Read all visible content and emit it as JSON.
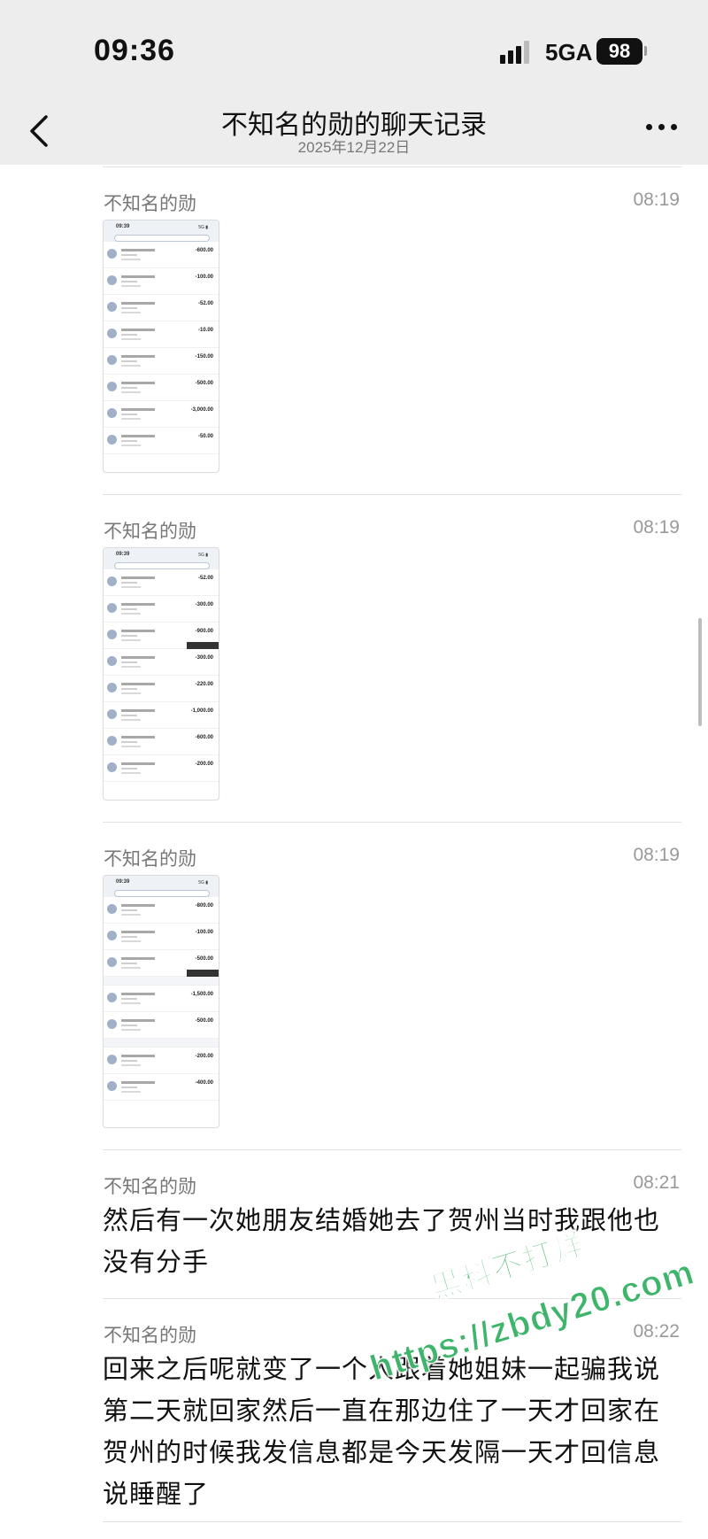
{
  "status_bar": {
    "time": "09:36",
    "network": "5GA",
    "battery": "98"
  },
  "nav": {
    "title": "不知名的勋的聊天记录",
    "date": "2025年12月22日"
  },
  "messages": [
    {
      "sender": "不知名的勋",
      "time": "08:19",
      "type": "image",
      "thumb_amounts": [
        "-600.00",
        "-100.00",
        "-52.00",
        "-10.00",
        "-150.00",
        "-500.00",
        "-3,000.00",
        "-50.00"
      ]
    },
    {
      "sender": "不知名的勋",
      "time": "08:19",
      "type": "image",
      "thumb_amounts": [
        "-52.00",
        "-300.00",
        "-900.00",
        "-300.00",
        "-220.00",
        "-1,000.00",
        "-600.00",
        "-200.00"
      ]
    },
    {
      "sender": "不知名的勋",
      "time": "08:19",
      "type": "image",
      "thumb_amounts": [
        "-800.00",
        "-100.00",
        "-500.00",
        "-1,500.00",
        "-500.00",
        "-200.00",
        "-400.00"
      ]
    },
    {
      "sender": "不知名的勋",
      "time": "08:21",
      "type": "text",
      "text": "然后有一次她朋友结婚她去了贺州当时我跟他也没有分手"
    },
    {
      "sender": "不知名的勋",
      "time": "08:22",
      "type": "text",
      "text": "回来之后呢就变了一个人跟着她姐妹一起骗我说第二天就回家然后一直在那边住了一天才回家在贺州的时候我发信息都是今天发隔一天才回信息说睡醒了"
    }
  ],
  "watermark": {
    "line1": "黑料不打烊",
    "line2": "https://zbdy20.com"
  },
  "icons": {
    "back": "chevron-left-icon",
    "more": "more-dots-icon",
    "signal": "signal-icon"
  }
}
